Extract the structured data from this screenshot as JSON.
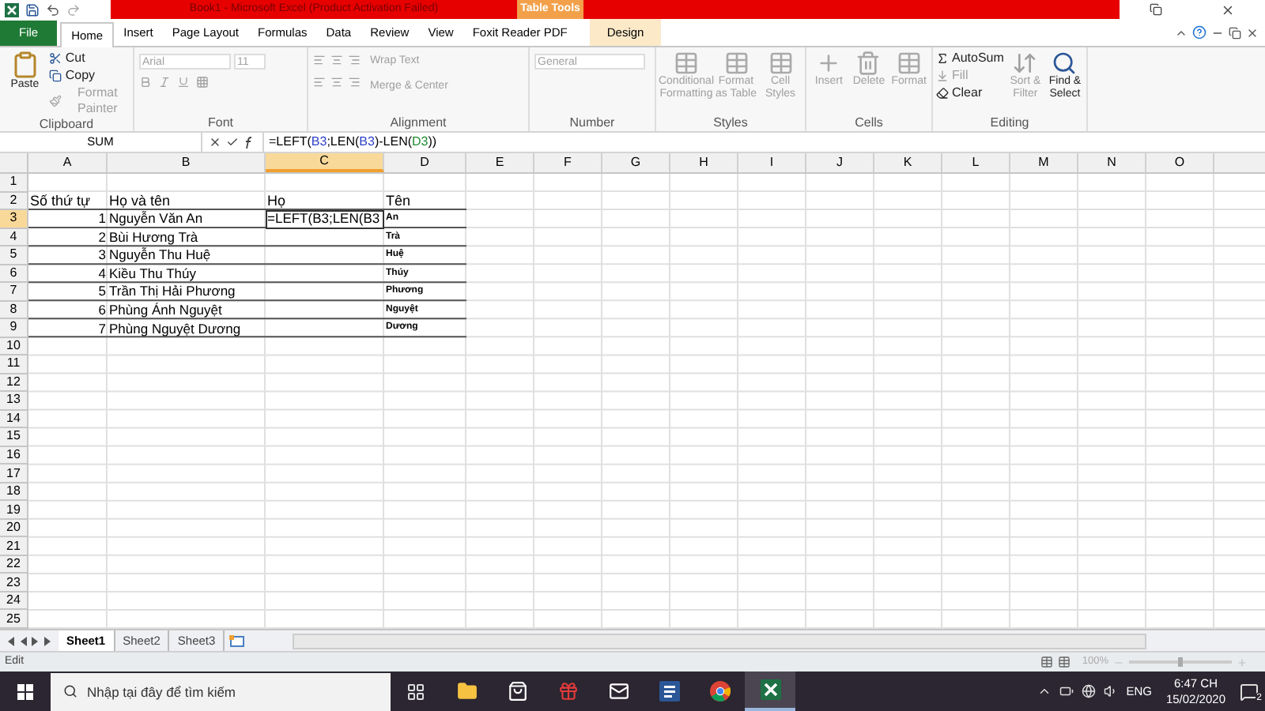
{
  "title_bar": {
    "title": "Book1 - Microsoft Excel (Product Activation Failed)",
    "context_tab": "Table Tools"
  },
  "ribbon_tabs": [
    {
      "label": "File",
      "selected": false,
      "kind": "file"
    },
    {
      "label": "Home",
      "selected": true,
      "kind": "normal"
    },
    {
      "label": "Insert",
      "selected": false,
      "kind": "normal"
    },
    {
      "label": "Page Layout",
      "selected": false,
      "kind": "normal"
    },
    {
      "label": "Formulas",
      "selected": false,
      "kind": "normal"
    },
    {
      "label": "Data",
      "selected": false,
      "kind": "normal"
    },
    {
      "label": "Review",
      "selected": false,
      "kind": "normal"
    },
    {
      "label": "View",
      "selected": false,
      "kind": "normal"
    },
    {
      "label": "Foxit Reader PDF",
      "selected": false,
      "kind": "normal"
    },
    {
      "label": "Design",
      "selected": false,
      "kind": "context"
    }
  ],
  "clipboard": {
    "label": "Clipboard",
    "paste": {
      "label": "Paste",
      "disabled": false
    },
    "cut": {
      "label": "Cut",
      "disabled": false
    },
    "copy": {
      "label": "Copy",
      "disabled": false
    },
    "format_painter": {
      "label": "Format Painter",
      "disabled": true
    }
  },
  "font": {
    "label": "Font",
    "font_name": "Arial",
    "font_size": "11",
    "disabled": true
  },
  "alignment": {
    "label": "Alignment",
    "wrap_text": "Wrap Text",
    "merge_center": "Merge & Center",
    "disabled": true
  },
  "number": {
    "label": "Number",
    "format": "General",
    "disabled": true
  },
  "styles": {
    "label": "Styles",
    "buttons": [
      {
        "label": "Conditional Formatting",
        "disabled": true
      },
      {
        "label": "Format as Table",
        "disabled": true
      },
      {
        "label": "Cell Styles",
        "disabled": true
      }
    ]
  },
  "cells_group": {
    "label": "Cells",
    "buttons": [
      {
        "label": "Insert",
        "disabled": true
      },
      {
        "label": "Delete",
        "disabled": true
      },
      {
        "label": "Format",
        "disabled": true
      }
    ]
  },
  "editing": {
    "label": "Editing",
    "autosum": {
      "label": "AutoSum",
      "disabled": false
    },
    "fill": {
      "label": "Fill",
      "disabled": true
    },
    "clear": {
      "label": "Clear",
      "disabled": false
    },
    "sort_filter": {
      "label": "Sort & Filter",
      "disabled": true
    },
    "find_select": {
      "label": "Find & Select",
      "disabled": false
    }
  },
  "formula_bar": {
    "name_box": "SUM",
    "formula": [
      {
        "text": "=LEFT(",
        "color": "#000000"
      },
      {
        "text": "B3",
        "color": "#2b3fc9"
      },
      {
        "text": ";LEN(",
        "color": "#000000"
      },
      {
        "text": "B3",
        "color": "#2b3fc9"
      },
      {
        "text": ")-LEN(",
        "color": "#000000"
      },
      {
        "text": "D3",
        "color": "#1d8a2e"
      },
      {
        "text": "))",
        "color": "#000000"
      }
    ]
  },
  "sheet": {
    "columns": [
      {
        "label": "A",
        "selected": false
      },
      {
        "label": "B",
        "selected": false
      },
      {
        "label": "C",
        "selected": true
      },
      {
        "label": "D",
        "selected": false
      },
      {
        "label": "E",
        "selected": false
      },
      {
        "label": "F",
        "selected": false
      },
      {
        "label": "G",
        "selected": false
      },
      {
        "label": "H",
        "selected": false
      },
      {
        "label": "I",
        "selected": false
      },
      {
        "label": "J",
        "selected": false
      },
      {
        "label": "K",
        "selected": false
      },
      {
        "label": "L",
        "selected": false
      },
      {
        "label": "M",
        "selected": false
      },
      {
        "label": "N",
        "selected": false
      },
      {
        "label": "O",
        "selected": false
      }
    ],
    "rows": [
      {
        "number": "1",
        "selected": false
      },
      {
        "number": "2",
        "selected": false,
        "kind": "header",
        "cells": [
          "Số thứ tự",
          "Họ và tên",
          "Họ",
          "Tên"
        ]
      },
      {
        "number": "3",
        "selected": true,
        "kind": "data",
        "editing": true,
        "cells": [
          "1",
          "Nguyễn Văn An",
          "=LEFT(B3;LEN(B3",
          "An"
        ]
      },
      {
        "number": "4",
        "selected": false,
        "kind": "data",
        "cells": [
          "2",
          "Bùi Hương Trà",
          "",
          "Trà"
        ]
      },
      {
        "number": "5",
        "selected": false,
        "kind": "data",
        "cells": [
          "3",
          "Nguyễn Thu Huệ",
          "",
          "Huệ"
        ]
      },
      {
        "number": "6",
        "selected": false,
        "kind": "data",
        "cells": [
          "4",
          "Kiều Thu Thúy",
          "",
          "Thúy"
        ]
      },
      {
        "number": "7",
        "selected": false,
        "kind": "data",
        "cells": [
          "5",
          "Trần Thị Hải Phương",
          "",
          "Phương"
        ]
      },
      {
        "number": "8",
        "selected": false,
        "kind": "data",
        "cells": [
          "6",
          "Phùng Ánh Nguyệt",
          "",
          "Nguyệt"
        ]
      },
      {
        "number": "9",
        "selected": false,
        "kind": "data",
        "cells": [
          "7",
          "Phùng Nguyệt Dương",
          "",
          "Dương"
        ]
      },
      {
        "number": "10",
        "selected": false
      },
      {
        "number": "11",
        "selected": false
      },
      {
        "number": "12",
        "selected": false
      },
      {
        "number": "13",
        "selected": false
      },
      {
        "number": "14",
        "selected": false
      },
      {
        "number": "15",
        "selected": false
      },
      {
        "number": "16",
        "selected": false
      },
      {
        "number": "17",
        "selected": false
      },
      {
        "number": "18",
        "selected": false
      },
      {
        "number": "19",
        "selected": false
      },
      {
        "number": "20",
        "selected": false
      },
      {
        "number": "21",
        "selected": false
      },
      {
        "number": "22",
        "selected": false
      },
      {
        "number": "23",
        "selected": false
      },
      {
        "number": "24",
        "selected": false
      },
      {
        "number": "25",
        "selected": false
      }
    ]
  },
  "sheet_tabs": [
    {
      "label": "Sheet1",
      "selected": true
    },
    {
      "label": "Sheet2",
      "selected": false
    },
    {
      "label": "Sheet3",
      "selected": false
    }
  ],
  "status_bar": {
    "mode": "Edit",
    "zoom": "100%",
    "zoom_slider": {
      "level": 0.5
    }
  },
  "taskbar": {
    "search_placeholder": "Nhập tại đây để tìm kiếm",
    "apps": [
      {
        "kind": "task-view",
        "selected": false
      },
      {
        "kind": "explorer",
        "selected": false
      },
      {
        "kind": "store",
        "selected": false
      },
      {
        "kind": "gift",
        "selected": false
      },
      {
        "kind": "mail",
        "selected": false
      },
      {
        "kind": "word",
        "selected": false
      },
      {
        "kind": "chrome",
        "selected": false
      },
      {
        "kind": "excel",
        "selected": true
      }
    ],
    "language": "ENG",
    "time": "6:47 CH",
    "date": "15/02/2020",
    "notifications": "2"
  }
}
